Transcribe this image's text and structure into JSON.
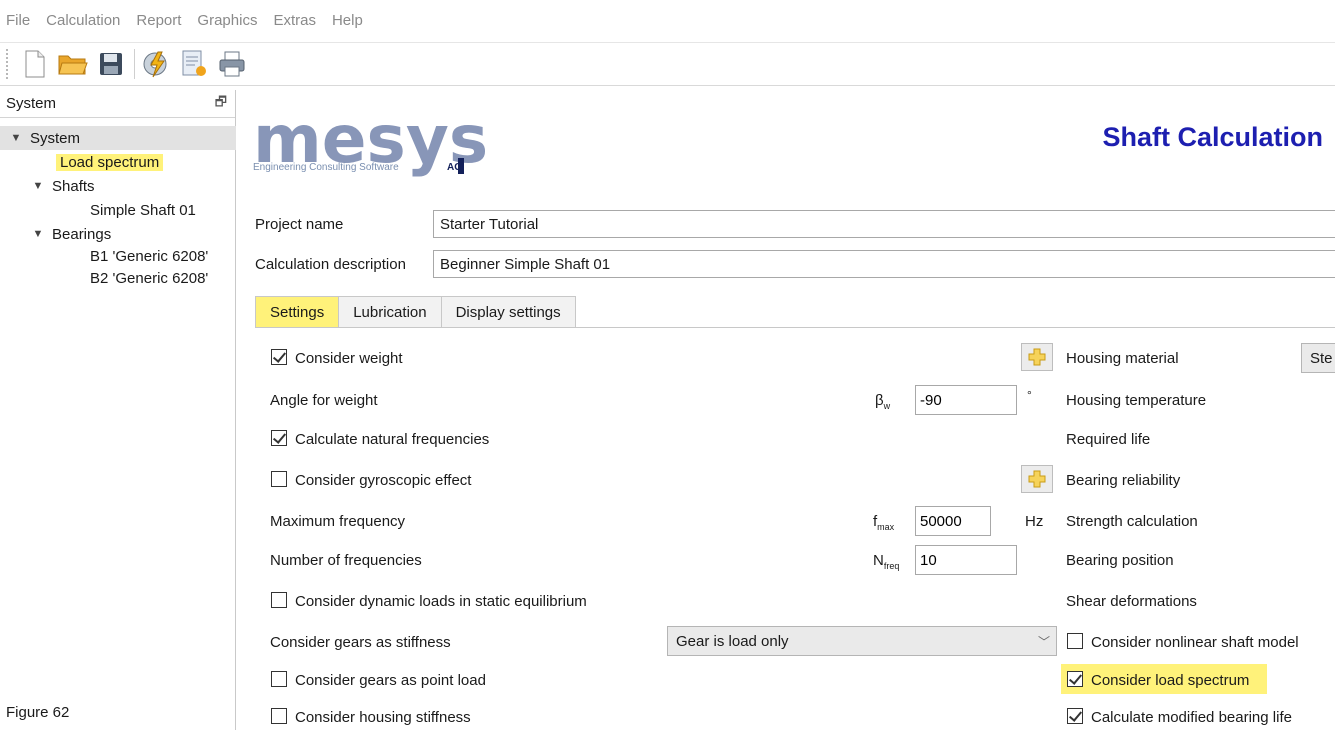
{
  "menu": {
    "items": [
      "File",
      "Calculation",
      "Report",
      "Graphics",
      "Extras",
      "Help"
    ]
  },
  "toolbar": {
    "icons": [
      "new-file-icon",
      "open-folder-icon",
      "save-icon",
      "calculate-icon",
      "report-icon",
      "print-icon"
    ]
  },
  "sidebar": {
    "title": "System",
    "tree": {
      "system": "System",
      "load_spectrum": "Load spectrum",
      "shafts": "Shafts",
      "shaft1": "Simple Shaft 01",
      "bearings": "Bearings",
      "bearing1": "B1 'Generic 6208'",
      "bearing2": "B2 'Generic 6208'"
    },
    "figure_label": "Figure 62"
  },
  "header": {
    "logo_text": "mesys",
    "logo_tagline": "Engineering Consulting Software",
    "logo_ag": "AG",
    "app_title": "Shaft Calculation"
  },
  "project": {
    "name_label": "Project name",
    "name_value": "Starter Tutorial",
    "desc_label": "Calculation description",
    "desc_value": "Beginner Simple Shaft 01"
  },
  "tabs": [
    "Settings",
    "Lubrication",
    "Display settings"
  ],
  "settings": {
    "consider_weight": "Consider weight",
    "angle_for_weight": "Angle for weight",
    "angle_symbol": "β",
    "angle_sub": "w",
    "angle_value": "-90",
    "angle_unit": "°",
    "natural_freq": "Calculate natural frequencies",
    "gyroscopic": "Consider gyroscopic effect",
    "max_freq": "Maximum frequency",
    "max_freq_symbol": "f",
    "max_freq_sub": "max",
    "max_freq_value": "50000",
    "max_freq_unit": "Hz",
    "num_freq": "Number of frequencies",
    "num_freq_symbol": "N",
    "num_freq_sub": "freq",
    "num_freq_value": "10",
    "dynamic_loads": "Consider dynamic loads in static equilibrium",
    "gears_stiffness": "Consider gears as stiffness",
    "gears_stiffness_value": "Gear is load only",
    "gears_point_load": "Consider gears as point load",
    "housing_stiffness": "Consider housing stiffness"
  },
  "right_settings": {
    "housing_material": "Housing material",
    "housing_material_value": "Ste",
    "housing_temp": "Housing temperature",
    "required_life": "Required life",
    "bearing_reliability": "Bearing reliability",
    "strength_calc": "Strength calculation",
    "bearing_position": "Bearing position",
    "shear_deformations": "Shear deformations",
    "nonlinear_model": "Consider nonlinear shaft model",
    "load_spectrum": "Consider load spectrum",
    "modified_life": "Calculate modified bearing life"
  }
}
